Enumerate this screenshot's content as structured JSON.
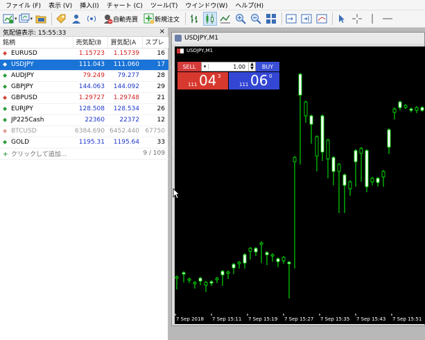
{
  "menu": [
    "ファイル (F)",
    "表示 (V)",
    "挿入(I)",
    "チャート (C)",
    "ツール(T)",
    "ウインドウ(W)",
    "ヘルプ(H)"
  ],
  "toolbar": {
    "auto_trade_label": "自動売買",
    "new_order_label": "新規注文"
  },
  "market_watch": {
    "title": "気配値表示: 15:55:33",
    "close": "×",
    "columns": [
      "銘柄",
      "売気配(B",
      "買気配(A",
      "スプレ"
    ],
    "rows": [
      {
        "symbol": "EURUSD",
        "bid": "1.15723",
        "ask": "1.15739",
        "spread": "16",
        "dir": "down",
        "bid_color": "red",
        "ask_color": "red"
      },
      {
        "symbol": "USDJPY",
        "bid": "111.043",
        "ask": "111.060",
        "spread": "17",
        "dir": "up",
        "selected": true,
        "bid_color": "blue",
        "ask_color": "blue"
      },
      {
        "symbol": "AUDJPY",
        "bid": "79.249",
        "ask": "79.277",
        "spread": "28",
        "dir": "up",
        "bid_color": "red",
        "ask_color": "blue"
      },
      {
        "symbol": "GBPJPY",
        "bid": "144.063",
        "ask": "144.092",
        "spread": "29",
        "dir": "up",
        "bid_color": "blue",
        "ask_color": "blue"
      },
      {
        "symbol": "GBPUSD",
        "bid": "1.29727",
        "ask": "1.29748",
        "spread": "21",
        "dir": "down",
        "bid_color": "red",
        "ask_color": "red"
      },
      {
        "symbol": "EURJPY",
        "bid": "128.508",
        "ask": "128.534",
        "spread": "26",
        "dir": "up",
        "bid_color": "blue",
        "ask_color": "blue"
      },
      {
        "symbol": "JP225Cash",
        "bid": "22360",
        "ask": "22372",
        "spread": "12",
        "dir": "up",
        "bid_color": "blue",
        "ask_color": "blue"
      },
      {
        "symbol": "BTCUSD",
        "bid": "6384.690",
        "ask": "6452.440",
        "spread": "67750",
        "dir": "dim",
        "dim": true,
        "bid_color": "blue",
        "ask_color": "red"
      },
      {
        "symbol": "GOLD",
        "bid": "1195.31",
        "ask": "1195.64",
        "spread": "33",
        "dir": "up",
        "bid_color": "blue",
        "ask_color": "blue"
      }
    ],
    "add_label": "クリックして追加...",
    "count": "9 / 109"
  },
  "chart_window": {
    "title": "USDJPY,M1",
    "inner_symbol": "USDJPY,M1",
    "sell_label": "SELL",
    "buy_label": "BUY",
    "volume": "1.00",
    "sell_prefix": "111",
    "sell_big": "04",
    "sell_sup": "3",
    "buy_prefix": "111",
    "buy_big": "06",
    "buy_sup": "0",
    "time_labels": [
      "7 Sep 2018",
      "7 Sep 15:11",
      "7 Sep 15:19",
      "7 Sep 15:27",
      "7 Sep 15:35",
      "7 Sep 15:43",
      "7 Sep 15:51"
    ]
  },
  "colors": {
    "selected_row": "#1a73d6",
    "sell": "#d7392f",
    "buy": "#3447d4",
    "bull": "#ffffff",
    "bear": "#00ff00",
    "chart_bg": "#000000"
  }
}
